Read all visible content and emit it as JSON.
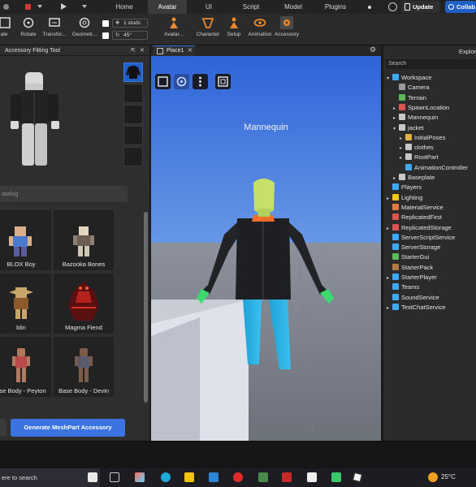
{
  "topbar": {
    "tabs": [
      "Home",
      "Avatar",
      "UI",
      "Script",
      "Model",
      "Plugins"
    ],
    "active_tab": "Avatar",
    "update_label": "Update",
    "collab_label": "Collab"
  },
  "ribbon": {
    "tools": [
      {
        "label": "ale",
        "icon": "scale-icon"
      },
      {
        "label": "Rotate",
        "icon": "rotate-icon"
      },
      {
        "label": "Transfor...",
        "icon": "transform-icon"
      },
      {
        "label": "Geometr...",
        "icon": "geometry-icon"
      },
      {
        "label": "Avatar...",
        "icon": "avatar-icon"
      },
      {
        "label": "Character",
        "icon": "character-icon"
      },
      {
        "label": "Setup",
        "icon": "setup-icon"
      },
      {
        "label": "Animation",
        "icon": "animation-icon"
      },
      {
        "label": "Accessory",
        "icon": "accessory-icon"
      }
    ],
    "move_increment": "1 studs",
    "rotate_increment": "45°"
  },
  "left_panel": {
    "title": "Accessory Fitting Tool",
    "catalog_placeholder": "atalog",
    "items": [
      {
        "label": "BLOX Boy"
      },
      {
        "label": "Bazooka Bones"
      },
      {
        "label": "blin"
      },
      {
        "label": "Magma Fiend"
      },
      {
        "label": "ase Body - Peyton"
      },
      {
        "label": "Base Body - Devin"
      }
    ],
    "generate_label": "Generate MeshPart Accessory"
  },
  "viewport": {
    "tab_label": "Place1",
    "mannequin_label": "Mannequin"
  },
  "explorer": {
    "title": "Explor",
    "search_placeholder": "Search",
    "tree": [
      {
        "label": "Workspace",
        "depth": 0,
        "expanded": true,
        "icon_color": "#3fa9f5"
      },
      {
        "label": "Camera",
        "depth": 1,
        "expanded": null,
        "icon_color": "#9a9a9a"
      },
      {
        "label": "Terrain",
        "depth": 1,
        "expanded": null,
        "icon_color": "#5cb85c"
      },
      {
        "label": "SpawnLocation",
        "depth": 1,
        "expanded": false,
        "icon_color": "#d9534f"
      },
      {
        "label": "Mannequin",
        "depth": 1,
        "expanded": false,
        "icon_color": "#c8c8c8"
      },
      {
        "label": "jacket",
        "depth": 1,
        "expanded": true,
        "icon_color": "#c8c8c8"
      },
      {
        "label": "InitialPoses",
        "depth": 2,
        "expanded": false,
        "icon_color": "#e0b040"
      },
      {
        "label": "clothes",
        "depth": 2,
        "expanded": false,
        "icon_color": "#c8c8c8"
      },
      {
        "label": "RootPart",
        "depth": 2,
        "expanded": false,
        "icon_color": "#c8c8c8"
      },
      {
        "label": "AnimationController",
        "depth": 2,
        "expanded": null,
        "icon_color": "#3fa9f5"
      },
      {
        "label": "Baseplate",
        "depth": 1,
        "expanded": false,
        "icon_color": "#c8c8c8"
      },
      {
        "label": "Players",
        "depth": 0,
        "expanded": null,
        "icon_color": "#3fa9f5"
      },
      {
        "label": "Lighting",
        "depth": 0,
        "expanded": false,
        "icon_color": "#f0c419"
      },
      {
        "label": "MaterialService",
        "depth": 0,
        "expanded": null,
        "icon_color": "#e07a3f"
      },
      {
        "label": "ReplicatedFirst",
        "depth": 0,
        "expanded": null,
        "icon_color": "#d9534f"
      },
      {
        "label": "ReplicatedStorage",
        "depth": 0,
        "expanded": false,
        "icon_color": "#d9534f"
      },
      {
        "label": "ServerScriptService",
        "depth": 0,
        "expanded": null,
        "icon_color": "#3fa9f5"
      },
      {
        "label": "ServerStorage",
        "depth": 0,
        "expanded": null,
        "icon_color": "#3fa9f5"
      },
      {
        "label": "StarterGui",
        "depth": 0,
        "expanded": null,
        "icon_color": "#5cb85c"
      },
      {
        "label": "StarterPack",
        "depth": 0,
        "expanded": null,
        "icon_color": "#b07a40"
      },
      {
        "label": "StarterPlayer",
        "depth": 0,
        "expanded": false,
        "icon_color": "#3fa9f5"
      },
      {
        "label": "Teams",
        "depth": 0,
        "expanded": null,
        "icon_color": "#3fa9f5"
      },
      {
        "label": "SoundService",
        "depth": 0,
        "expanded": null,
        "icon_color": "#3fa9f5"
      },
      {
        "label": "TextChatService",
        "depth": 0,
        "expanded": false,
        "icon_color": "#3fa9f5"
      }
    ]
  },
  "taskbar": {
    "search_label": "ere to search",
    "weather": "25°C"
  }
}
